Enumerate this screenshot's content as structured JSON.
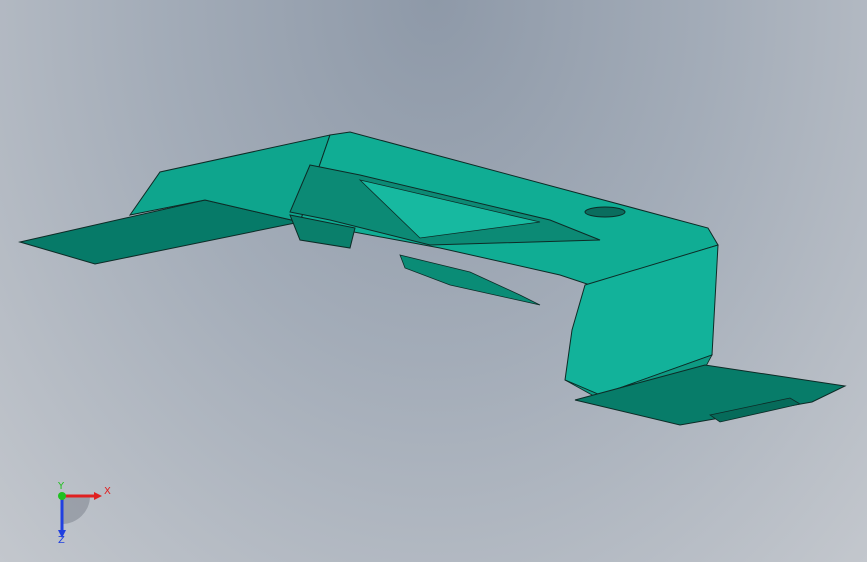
{
  "viewport": {
    "background_top": "#8e99a8",
    "background_bottom": "#c3c7cd"
  },
  "model": {
    "color": "#00a088",
    "edge_color": "#0d2b26"
  },
  "triad": {
    "x_label": "X",
    "y_label": "Y",
    "z_label": "Z",
    "x_color": "#e02020",
    "y_color": "#20c020",
    "z_color": "#2040e0"
  }
}
